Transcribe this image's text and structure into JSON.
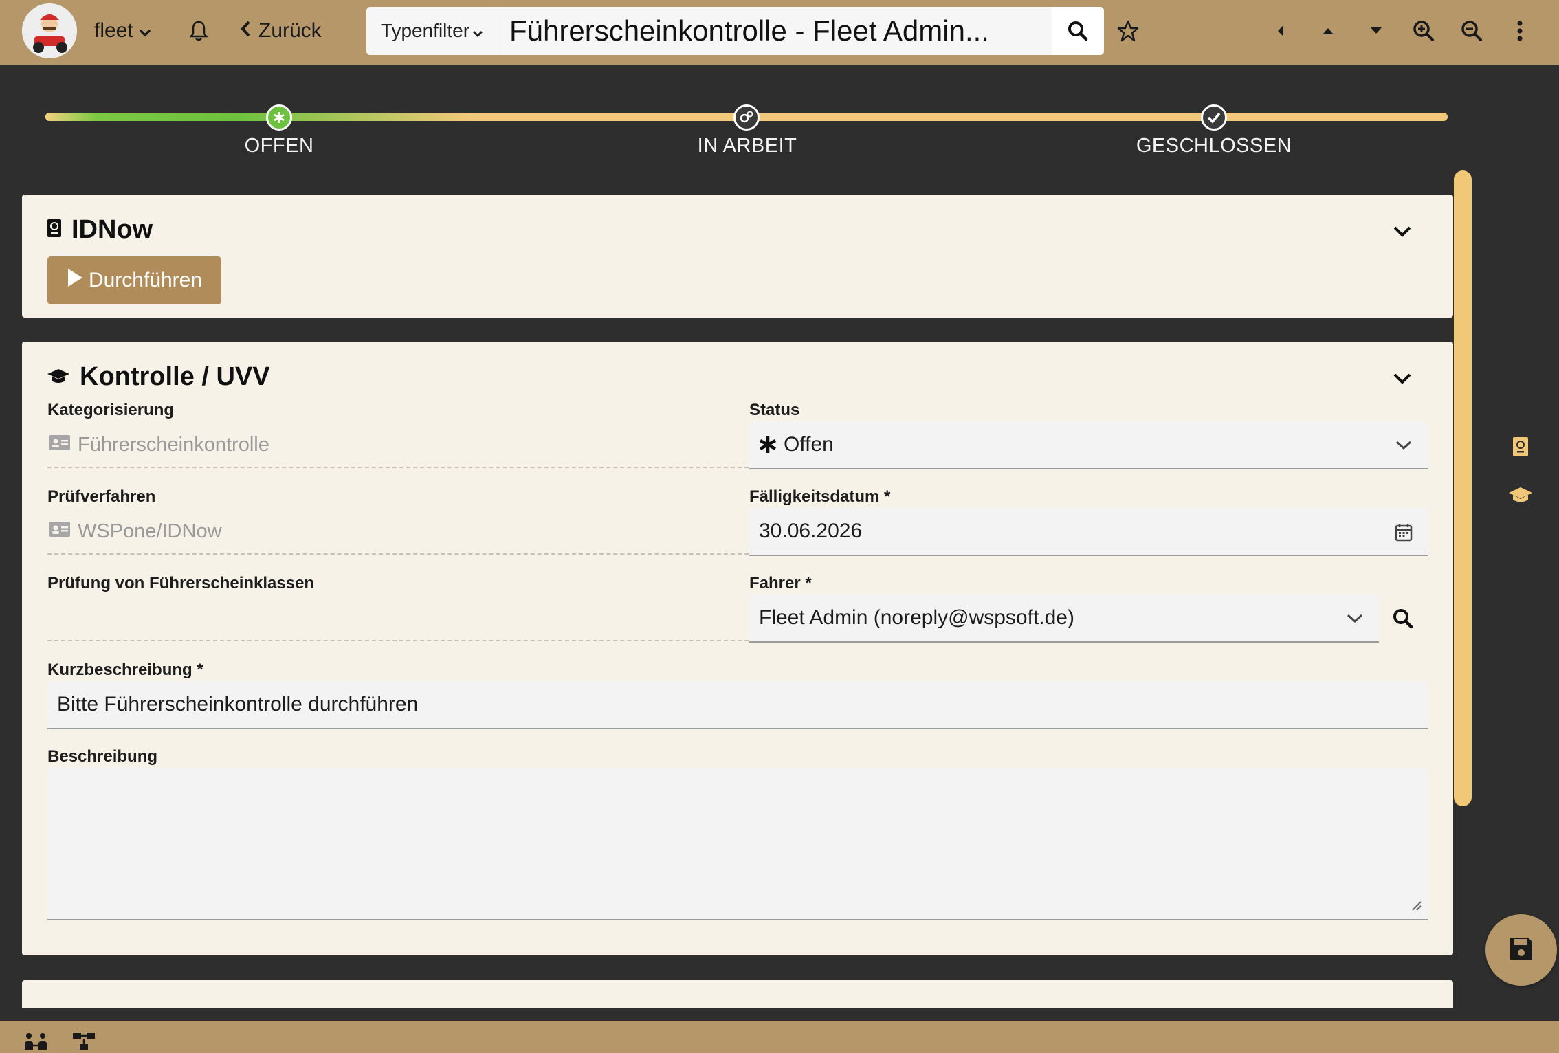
{
  "topbar": {
    "app_name": "fleet",
    "back_label": "Zurück",
    "type_filter_label": "Typenfilter",
    "search_value": "Führerscheinkontrolle - Fleet Admin..."
  },
  "stepper": {
    "steps": [
      {
        "label": "OFFEN",
        "state": "active"
      },
      {
        "label": "IN ARBEIT",
        "state": "pending"
      },
      {
        "label": "GESCHLOSSEN",
        "state": "pending"
      }
    ]
  },
  "idnow_card": {
    "title": "IDNow",
    "run_label": "Durchführen"
  },
  "control_card": {
    "title": "Kontrolle / UVV",
    "kategorisierung_label": "Kategorisierung",
    "kategorisierung_value": "Führerscheinkontrolle",
    "status_label": "Status",
    "status_value": "Offen",
    "pruefverfahren_label": "Prüfverfahren",
    "pruefverfahren_value": "WSPone/IDNow",
    "faelligkeit_label": "Fälligkeitsdatum *",
    "faelligkeit_value": "30.06.2026",
    "klassen_label": "Prüfung von Führerscheinklassen",
    "klassen_value": "",
    "fahrer_label": "Fahrer *",
    "fahrer_value": "Fleet Admin (noreply@wspsoft.de)",
    "kurz_label": "Kurzbeschreibung *",
    "kurz_value": "Bitte Führerscheinkontrolle durchführen",
    "beschreibung_label": "Beschreibung",
    "beschreibung_value": ""
  },
  "colors": {
    "accent": "#b5976a",
    "button": "#b18c5b",
    "card_bg": "#f6f2e8",
    "step_active": "#6cc23e",
    "track": "#f2c97a"
  }
}
